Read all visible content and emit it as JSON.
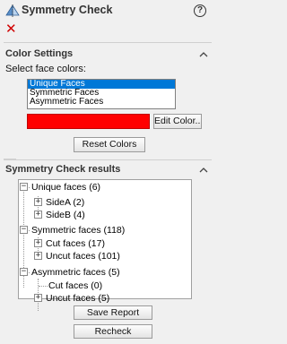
{
  "title": "Symmetry Check",
  "help_icon": "?",
  "close_icon": "✕",
  "colors": {
    "selection": "#0078d7",
    "face_color": "#ff0000",
    "close": "#d00000"
  },
  "color_settings": {
    "header": "Color Settings",
    "prompt": "Select face colors:",
    "options": [
      "Unique Faces",
      "Symmetric Faces",
      "Asymmetric Faces"
    ],
    "selected": "Unique Faces",
    "edit_color_label": "Edit Color...",
    "reset_colors_label": "Reset Colors"
  },
  "results": {
    "header": "Symmetry Check results",
    "tree": {
      "unique": "Unique faces (6)",
      "unique_sideA": "SideA (2)",
      "unique_sideB": "SideB (4)",
      "symmetric": "Symmetric faces (118)",
      "symmetric_cut": "Cut faces (17)",
      "symmetric_uncut": "Uncut faces (101)",
      "asymmetric": "Asymmetric faces (5)",
      "asymmetric_cut": "Cut faces (0)",
      "asymmetric_uncut": "Uncut faces (5)"
    },
    "save_report_label": "Save Report",
    "recheck_label": "Recheck"
  }
}
